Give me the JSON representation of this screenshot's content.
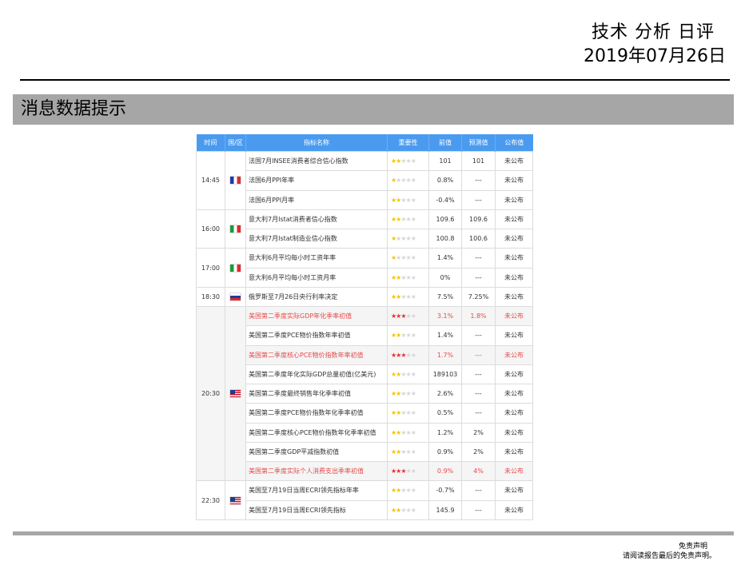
{
  "header": {
    "title": "技术 分析 日评",
    "date": "2019年07月26日"
  },
  "section": {
    "title": "消息数据提示"
  },
  "table": {
    "columns": [
      "时间",
      "国/区",
      "指标名称",
      "重要性",
      "前值",
      "预测值",
      "公布值"
    ],
    "groups": [
      {
        "time": "14:45",
        "flag": "fr-flag-icon",
        "rows": [
          {
            "name": "法国7月INSEE消费者综合信心指数",
            "stars": 2,
            "prev": "101",
            "forecast": "101",
            "actual": "未公布",
            "hl": false
          },
          {
            "name": "法国6月PPI年率",
            "stars": 1,
            "prev": "0.8%",
            "forecast": "---",
            "actual": "未公布",
            "hl": false
          },
          {
            "name": "法国6月PPI月率",
            "stars": 2,
            "prev": "-0.4%",
            "forecast": "---",
            "actual": "未公布",
            "hl": false
          }
        ]
      },
      {
        "time": "16:00",
        "flag": "it-flag-icon",
        "rows": [
          {
            "name": "意大利7月Istat消费者信心指数",
            "stars": 2,
            "prev": "109.6",
            "forecast": "109.6",
            "actual": "未公布",
            "hl": false
          },
          {
            "name": "意大利7月Istat制造业信心指数",
            "stars": 1,
            "prev": "100.8",
            "forecast": "100.6",
            "actual": "未公布",
            "hl": false
          }
        ]
      },
      {
        "time": "17:00",
        "flag": "it-flag-icon",
        "rows": [
          {
            "name": "意大利6月平均每小时工资年率",
            "stars": 1,
            "prev": "1.4%",
            "forecast": "---",
            "actual": "未公布",
            "hl": false
          },
          {
            "name": "意大利6月平均每小时工资月率",
            "stars": 2,
            "prev": "0%",
            "forecast": "---",
            "actual": "未公布",
            "hl": false
          }
        ]
      },
      {
        "time": "18:30",
        "flag": "ru-flag-icon",
        "rows": [
          {
            "name": "俄罗斯至7月26日央行利率决定",
            "stars": 2,
            "prev": "7.5%",
            "forecast": "7.25%",
            "actual": "未公布",
            "hl": false
          }
        ]
      },
      {
        "time": "20:30",
        "flag": "us-flag-icon",
        "rows": [
          {
            "name": "美国第二季度实际GDP年化季率初值",
            "stars": 3,
            "prev": "3.1%",
            "forecast": "1.8%",
            "actual": "未公布",
            "hl": true
          },
          {
            "name": "美国第二季度PCE物价指数年率初值",
            "stars": 2,
            "prev": "1.4%",
            "forecast": "---",
            "actual": "未公布",
            "hl": false
          },
          {
            "name": "美国第二季度核心PCE物价指数年率初值",
            "stars": 3,
            "prev": "1.7%",
            "forecast": "---",
            "actual": "未公布",
            "hl": true
          },
          {
            "name": "美国第二季度年化实际GDP总量初值(亿美元)",
            "stars": 2,
            "prev": "189103",
            "forecast": "---",
            "actual": "未公布",
            "hl": false
          },
          {
            "name": "美国第二季度最终销售年化季率初值",
            "stars": 2,
            "prev": "2.6%",
            "forecast": "---",
            "actual": "未公布",
            "hl": false
          },
          {
            "name": "美国第二季度PCE物价指数年化季率初值",
            "stars": 2,
            "prev": "0.5%",
            "forecast": "---",
            "actual": "未公布",
            "hl": false
          },
          {
            "name": "美国第二季度核心PCE物价指数年化季率初值",
            "stars": 2,
            "prev": "1.2%",
            "forecast": "2%",
            "actual": "未公布",
            "hl": false
          },
          {
            "name": "美国第二季度GDP平减指数初值",
            "stars": 2,
            "prev": "0.9%",
            "forecast": "2%",
            "actual": "未公布",
            "hl": false
          },
          {
            "name": "美国第二季度实际个人消费支出季率初值",
            "stars": 3,
            "prev": "0.9%",
            "forecast": "4%",
            "actual": "未公布",
            "hl": true
          }
        ]
      },
      {
        "time": "22:30",
        "flag": "us-flag-icon",
        "rows": [
          {
            "name": "美国至7月19日当周ECRI领先指标年率",
            "stars": 2,
            "prev": "-0.7%",
            "forecast": "---",
            "actual": "未公布",
            "hl": false
          },
          {
            "name": "美国至7月19日当周ECRI领先指标",
            "stars": 2,
            "prev": "145.9",
            "forecast": "---",
            "actual": "未公布",
            "hl": false
          }
        ]
      }
    ]
  },
  "footer": {
    "line1": "免责声明",
    "line2": "请阅读报告最后的免责声明。"
  }
}
